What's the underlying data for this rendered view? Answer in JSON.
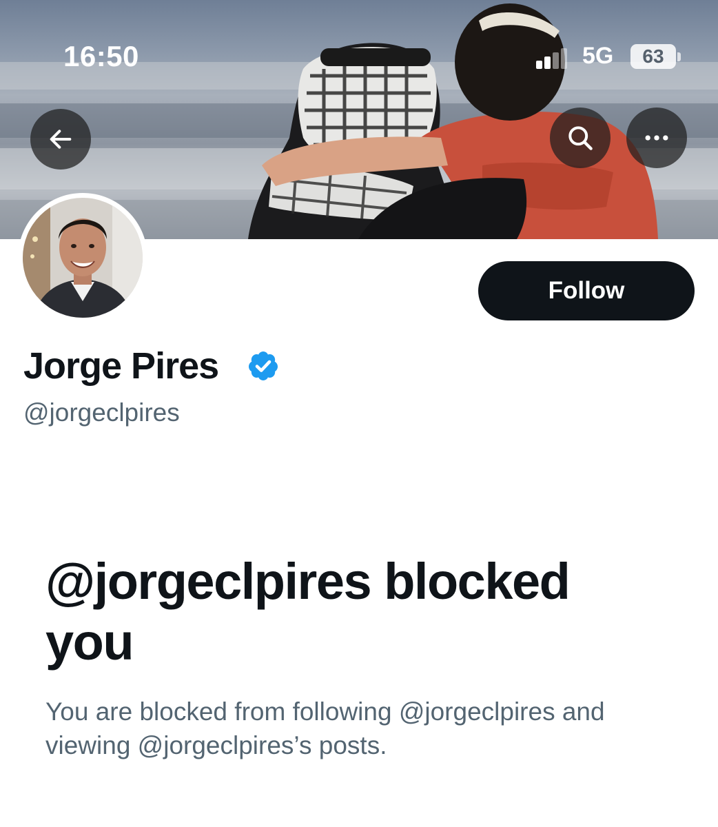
{
  "status_bar": {
    "time": "16:50",
    "network": "5G",
    "battery": "63"
  },
  "header": {
    "back_icon": "arrow-left-icon",
    "search_icon": "search-icon",
    "more_icon": "more-horizontal-icon"
  },
  "profile": {
    "display_name": "Jorge Pires",
    "handle": "@jorgeclpires",
    "verified": true,
    "follow_label": "Follow"
  },
  "blocked": {
    "title": "@jorgeclpires blocked you",
    "description": "You are blocked from following @jorgeclpires and viewing @jorgeclpires’s posts."
  },
  "colors": {
    "primary_text": "#0f1419",
    "secondary_text": "#536471",
    "verified_blue": "#1d9bf0",
    "follow_button": "#0f1419"
  }
}
